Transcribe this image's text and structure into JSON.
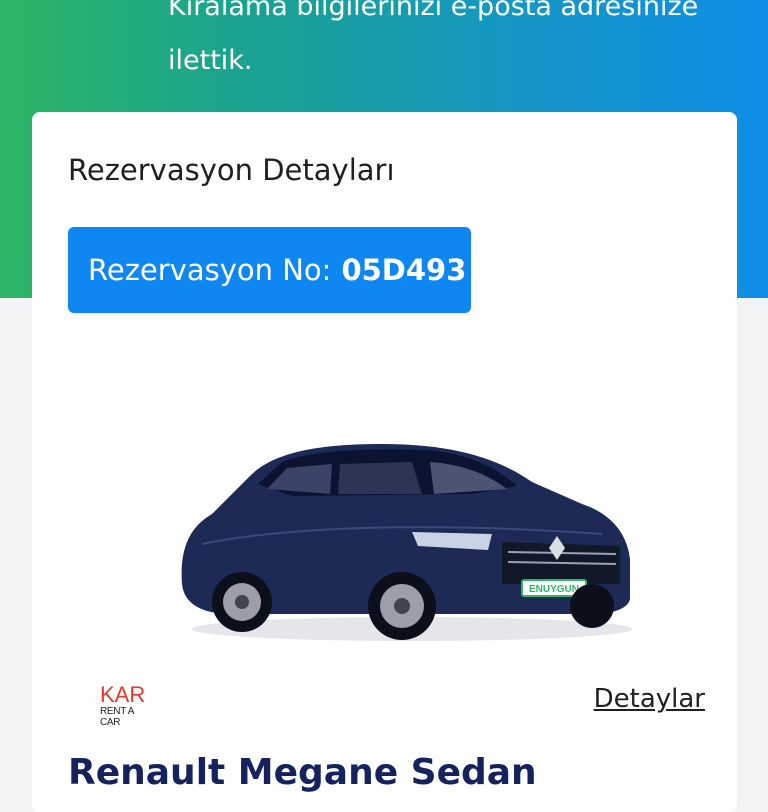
{
  "hero": {
    "text_line1": "Kiralama bilgilerinizi e-posta adresinize",
    "text_line2": "ilettik."
  },
  "reservation": {
    "title": "Rezervasyon Detayları",
    "number_label": "Rezervasyon No:",
    "number_value": "05D493",
    "badge_color": "#0f87f3"
  },
  "vehicle": {
    "plate_label": "ENUYGUN",
    "name": "Renault Megane Sedan"
  },
  "vendor": {
    "logo_top": "KAR",
    "logo_bottom": "RENT A CAR"
  },
  "actions": {
    "details_label": "Detaylar"
  },
  "colors": {
    "gradient_start": "#2eb565",
    "gradient_end": "#0e8ee6",
    "car_body": "#1d2a55",
    "title_text": "#16225e"
  }
}
